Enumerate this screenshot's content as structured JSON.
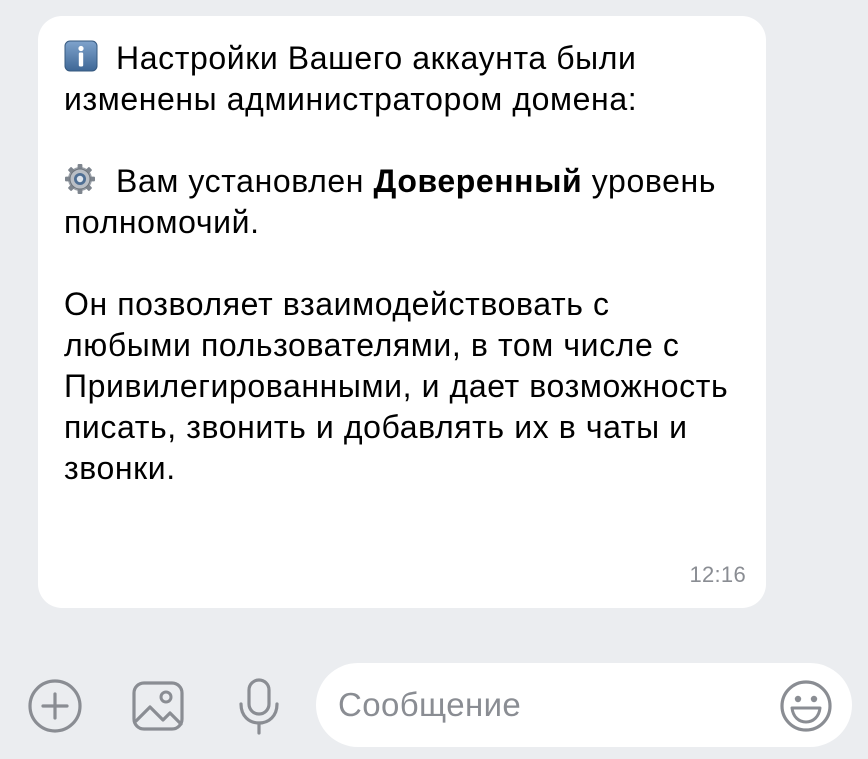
{
  "message": {
    "line1_text": "Настройки Вашего аккаунта были изменены администратором домена:",
    "line2_before": "Вам установлен ",
    "line2_bold": "Доверенный",
    "line2_after": " уровень полномочий.",
    "line3_text": "Он позволяет взаимодействовать с любыми пользователями, в том числе с Привилегированными, и дает возможность писать, звонить и добавлять их в чаты и звонки.",
    "time": "12:16",
    "icons": [
      "info-icon",
      "gear-icon"
    ]
  },
  "composer": {
    "placeholder": "Сообщение",
    "value": "",
    "icons": [
      "plus-circle-icon",
      "image-icon",
      "microphone-icon",
      "smile-icon"
    ]
  },
  "colors": {
    "background": "#ebedf0",
    "bubble": "#ffffff",
    "secondary_text": "#8a8d93",
    "icon_gray": "#8a8d93",
    "info_icon_blue": "#4a74a8"
  }
}
